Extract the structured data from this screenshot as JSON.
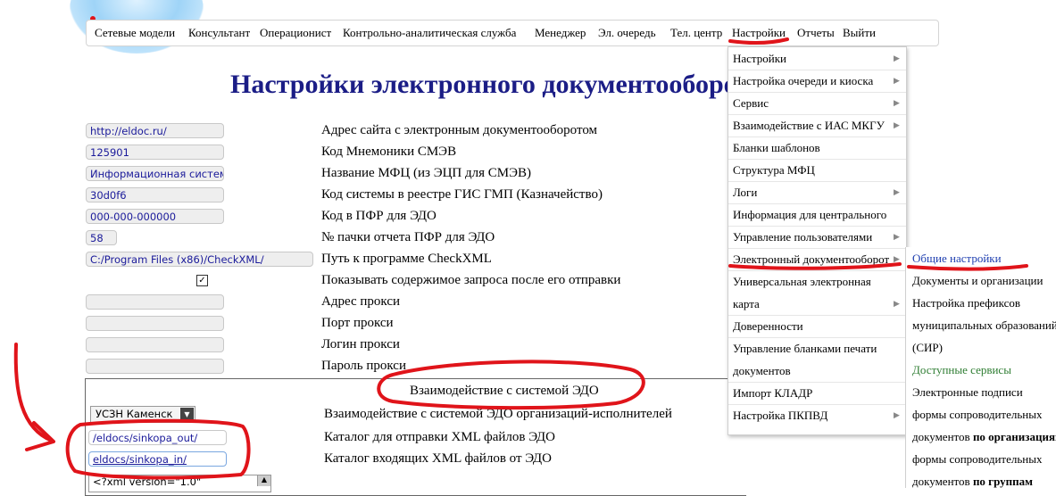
{
  "nav": {
    "items": [
      "Сетевые модели",
      "Консультант",
      "Операционист",
      "Контрольно-аналитическая служба",
      "Менеджер",
      "Эл. очередь",
      "Тел. центр",
      "Настройки",
      "Отчеты",
      "Выйти"
    ]
  },
  "page": {
    "title": "Настройки электронного документооборота"
  },
  "fields": [
    {
      "value": "http://eldoc.ru/",
      "label": "Адрес сайта с электронным документооборотом"
    },
    {
      "value": "125901",
      "label": "Код Мнемоники СМЭВ"
    },
    {
      "value": "Информационная система",
      "label": "Название МФЦ (из ЭЦП для СМЭВ)"
    },
    {
      "value": "30d0f6",
      "label": "Код системы в реестре ГИС ГМП (Казначейство)"
    },
    {
      "value": "000-000-000000",
      "label": "Код в ПФР для ЭДО"
    },
    {
      "value": "58",
      "label": "№ пачки отчета ПФР для ЭДО"
    },
    {
      "value": "C:/Program Files (x86)/CheckXML/",
      "label": "Путь к программе CheckXML"
    },
    {
      "value": "✓",
      "label": "Показывать содержимое запроса после его отправки"
    },
    {
      "value": "",
      "label": "Адрес прокси"
    },
    {
      "value": "",
      "label": "Порт прокси"
    },
    {
      "value": "",
      "label": "Логин прокси"
    },
    {
      "value": "",
      "label": "Пароль прокси"
    }
  ],
  "edo": {
    "section_title": "Взаимодействие с системой ЭДО",
    "org_select": "УСЗН Каменск",
    "org_label": "Взаимодействие с системой ЭДО организаций-исполнителей",
    "out_dir": "/eldocs/sinkopa_out/",
    "out_label": "Каталог для отправки XML файлов ЭДО",
    "in_dir": "eldocs/sinkopa_in/",
    "in_label": "Каталог входящих XML файлов от ЭДО",
    "xml_text": "<?xml version=\"1.0\""
  },
  "dropdown": {
    "items": [
      "Настройки",
      "Настройка очереди и киоска",
      "Сервис",
      "Взаимодействие с ИАС МКГУ",
      "Бланки шаблонов",
      "Структура МФЦ",
      "Логи",
      "Информация для центрального",
      "Управление пользователями",
      "Электронный документооборот",
      "Универсальная электронная",
      "карта",
      "Доверенности",
      "Управление бланками печати",
      "документов",
      "Импорт КЛАДР",
      "Настройка ПКПВД"
    ]
  },
  "submenu": {
    "items": [
      "Общие настройки",
      "Документы и организации",
      "Настройка префиксов",
      "муниципальных образований",
      "(СИР)",
      "Доступные сервисы",
      "Электронные подписи",
      "формы сопроводительных",
      "документов",
      "по организациям",
      "формы сопроводительных",
      "документов",
      "по группам"
    ]
  },
  "colors": {
    "title": "#1b1d86",
    "field_text": "#1a1a9a",
    "link_blue": "#1f3fb0",
    "link_green": "#2e7d32",
    "annotation": "#e0141a"
  }
}
